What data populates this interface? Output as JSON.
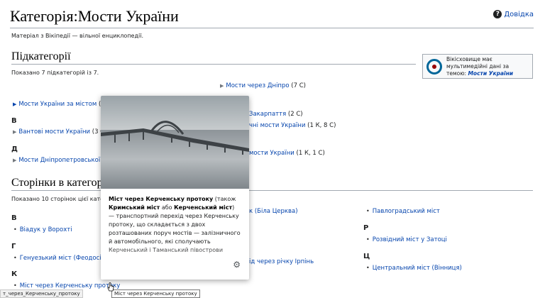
{
  "title": "Категорія:Мости України",
  "help": "Довідка",
  "tagline": "Матеріал з Вікіпедії — вільної енциклопедії.",
  "subcats": {
    "heading": "Підкатегорії",
    "count": "Показано 7 підкатегорій із 7.",
    "dnipro": {
      "label": "Мости через Дніпро",
      "count": "(7 С)"
    },
    "mosty_za_mistom": {
      "label": "Мости України за містом",
      "count": "(1"
    },
    "zakarpattia": {
      "label": "Закарпаття",
      "count": "(2 С)"
    },
    "zaliznychni": {
      "label": "чні мости України",
      "count": "(1 К, 8 С)"
    },
    "letter_v": "В",
    "vantovi": {
      "label": "Вантові мости України",
      "count": "(3 С"
    },
    "letter_d": "Д",
    "dnipropetrovska": {
      "label": "Мости Дніпропетровської о"
    },
    "third_col": {
      "label": "мости України",
      "count": "(1 К, 1 С)"
    }
  },
  "commons": {
    "text": "Вікісховище має мультимедійні дані за темою:",
    "link": "Мости України"
  },
  "pages": {
    "heading": "Сторінки в категорії",
    "count": "Показано 10 сторінок цієї катег",
    "col1": [
      {
        "letter": "В",
        "item": "Віадук у Ворохті"
      },
      {
        "letter": "Г",
        "item": "Генуезький міст (Феодосія"
      },
      {
        "letter": "К",
        "item": "Міст через Керченську протоку"
      }
    ],
    "col2_a": "к (Біла Церква)",
    "col2_b": "ід через річку Ірпінь",
    "col3_item1": "Павлоградський міст",
    "col3_letter_r": "Р",
    "col3_item2": "Розвідний міст у Затоці",
    "col3_letter_ts": "Ц",
    "col3_item3": "Центральний міст (Вінниця)"
  },
  "popup": {
    "b1": "Міст через Керченську протоку",
    "t1": " (також ",
    "b2": "Кримський міст",
    "t2": " або ",
    "b3": "Керченський міст",
    "t3": ") — транспортний перехід через Керченську протоку, що складається з двох розташованих поруч мостів — залізничного й автомобільного, які сполучають Керченський і Таманський півострови"
  },
  "status_url": "т_через_Керченську_протоку",
  "tooltip": "Міст через Керченську протоку",
  "colors": {
    "link": "#0645ad",
    "rule": "#a2a9b1"
  }
}
